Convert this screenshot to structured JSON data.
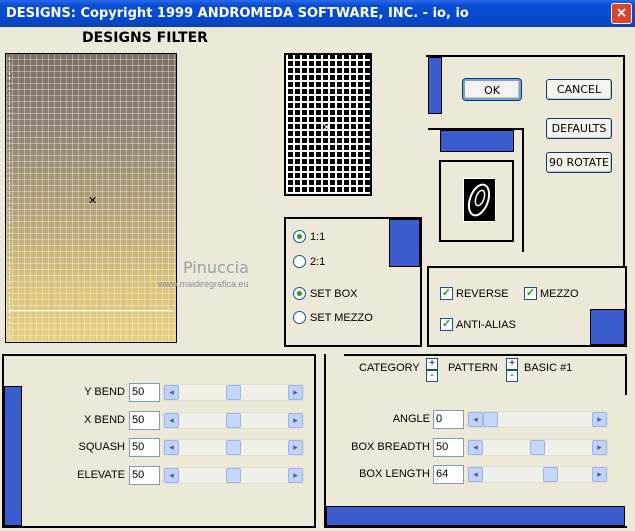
{
  "window": {
    "title": "DESIGNS: Copyright 1999 ANDROMEDA SOFTWARE, INC. - io, io",
    "close_glyph": "×"
  },
  "heading": "DESIGNS FILTER",
  "watermark": {
    "name": "Pinuccia",
    "url": "www.maidiregrafica.eu"
  },
  "buttons": {
    "ok": "OK",
    "cancel": "CANCEL",
    "defaults": "DEFAULTS",
    "rotate": "90 ROTATE"
  },
  "mode_options": {
    "one_to_one": "1:1",
    "two_to_one": "2:1",
    "set_box": "SET BOX",
    "set_mezzo": "SET MEZZO"
  },
  "checkboxes": {
    "reverse": "REVERSE",
    "mezzo": "MEZZO",
    "anti_alias": "ANTI-ALIAS"
  },
  "left_sliders": [
    {
      "label": "Y BEND",
      "value": "50",
      "position": 0.5
    },
    {
      "label": "X BEND",
      "value": "50",
      "position": 0.5
    },
    {
      "label": "SQUASH",
      "value": "50",
      "position": 0.5
    },
    {
      "label": "ELEVATE",
      "value": "50",
      "position": 0.5
    }
  ],
  "category": {
    "label": "CATEGORY",
    "pattern_label": "PATTERN",
    "value": "BASIC #1"
  },
  "right_sliders": [
    {
      "label": "ANGLE",
      "value": "0",
      "position": 0.0
    },
    {
      "label": "BOX BREADTH",
      "value": "50",
      "position": 0.5
    },
    {
      "label": "BOX LENGTH",
      "value": "64",
      "position": 0.64
    }
  ],
  "icons": {
    "stepper_plus": "+",
    "stepper_minus": "-",
    "arrow_left": "◂",
    "arrow_right": "▸"
  },
  "colors": {
    "accent_blue": "#3a5ccc",
    "title_blue": "#0a4cd6",
    "background": "#ece9d8"
  }
}
